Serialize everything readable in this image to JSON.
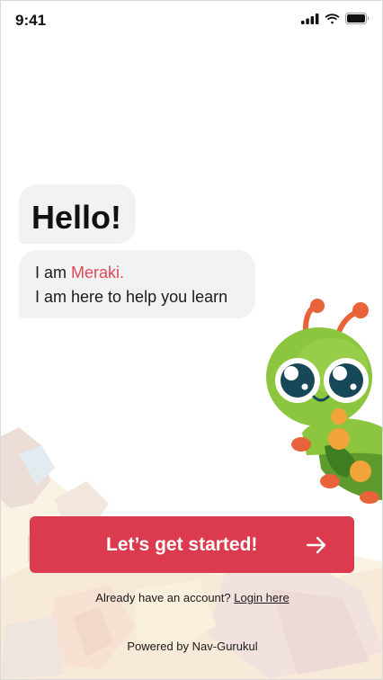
{
  "status_bar": {
    "time": "9:41"
  },
  "greeting": {
    "hello": "Hello!",
    "intro_prefix": "I am ",
    "assistant_name": "Meraki.",
    "intro_line2": "I am here to help you learn"
  },
  "cta": {
    "label": "Let’s get started!",
    "icon": "arrow-right-icon"
  },
  "login": {
    "prompt": "Already have an account? ",
    "link": "Login here"
  },
  "footer": {
    "powered_by": "Powered by Nav-Gurukul"
  },
  "colors": {
    "accent": "#dc3a4f",
    "accent_text": "#e0475a",
    "bubble": "#f2f2f2",
    "mascot_green": "#8cc63f"
  }
}
